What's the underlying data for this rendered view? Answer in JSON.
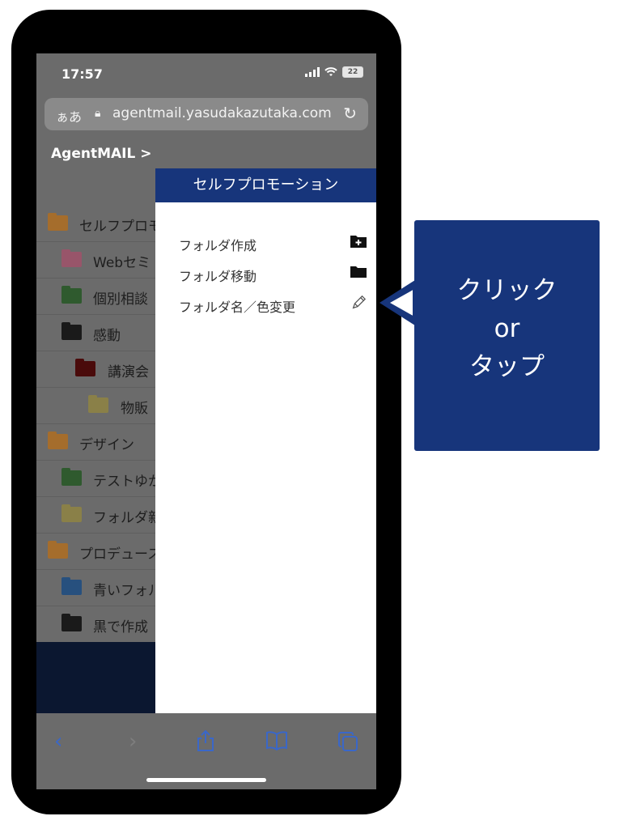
{
  "status": {
    "time": "17:57",
    "battery": "22"
  },
  "browser": {
    "aa_label": "ぁあ",
    "url": "agentmail.yasudakazutaka.com"
  },
  "breadcrumb": "AgentMAIL >",
  "folders": [
    {
      "name": "セルフプロモ",
      "color": "#a56d2c",
      "level": 0
    },
    {
      "name": "Webセミ",
      "color": "#98556a",
      "level": 1
    },
    {
      "name": "個別相談",
      "color": "#2f5a2e",
      "level": 1
    },
    {
      "name": "感動",
      "color": "#1a1a1a",
      "level": 1
    },
    {
      "name": "講演会",
      "color": "#4a0b0b",
      "level": 2
    },
    {
      "name": "物販",
      "color": "#8a8048",
      "level": 3
    },
    {
      "name": "デザイン",
      "color": "#a56d2c",
      "level": 0
    },
    {
      "name": "テストゆか",
      "color": "#2f5a2e",
      "level": 1
    },
    {
      "name": "フォルダ新",
      "color": "#8a8048",
      "level": 1
    },
    {
      "name": "プロデュース",
      "color": "#a56d2c",
      "level": 0
    },
    {
      "name": "青いフォル",
      "color": "#27507e",
      "level": 1
    },
    {
      "name": "黒で作成",
      "color": "#1a1a1a",
      "level": 1
    }
  ],
  "panel": {
    "title": "セルフプロモーション",
    "items": [
      {
        "label": "フォルダ作成",
        "icon": "folder-plus-icon"
      },
      {
        "label": "フォルダ移動",
        "icon": "folder-icon"
      },
      {
        "label": "フォルダ名／色変更",
        "icon": "pencil-icon"
      }
    ]
  },
  "callout": {
    "line1": "クリック",
    "line2": "or",
    "line3": "タップ"
  },
  "colors": {
    "navy": "#17357b",
    "dim": "#6b6b6b",
    "link_blue": "#3a67c8"
  }
}
